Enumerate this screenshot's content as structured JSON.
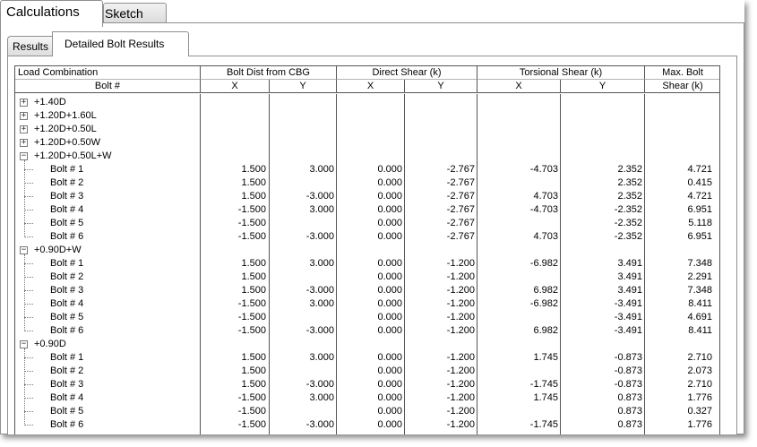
{
  "outer_tabs": [
    {
      "label": "Calculations",
      "active": true
    },
    {
      "label": "Sketch",
      "active": false
    }
  ],
  "inner_tabs": [
    {
      "label": "Results",
      "active": false
    },
    {
      "label": "Detailed Bolt Results",
      "active": true
    }
  ],
  "headers": {
    "load_combination": "Load Combination",
    "bolt_num": "Bolt #",
    "bolt_dist": "Bolt Dist from CBG",
    "direct_shear": "Direct Shear  (k)",
    "torsional_shear": "Torsional Shear  (k)",
    "max_bolt": "Max. Bolt",
    "max_bolt_shear": "Shear  (k)",
    "x": "X",
    "y": "Y"
  },
  "groups": [
    {
      "name": "+1.40D",
      "expanded": false,
      "bolts": []
    },
    {
      "name": "+1.20D+1.60L",
      "expanded": false,
      "bolts": []
    },
    {
      "name": "+1.20D+0.50L",
      "expanded": false,
      "bolts": []
    },
    {
      "name": "+1.20D+0.50W",
      "expanded": false,
      "bolts": []
    },
    {
      "name": "+1.20D+0.50L+W",
      "expanded": true,
      "bolts": [
        {
          "name": "Bolt # 1",
          "dx": "1.500",
          "dy": "3.000",
          "sx": "0.000",
          "sy": "-2.767",
          "tx": "-4.703",
          "ty": "2.352",
          "max": "4.721"
        },
        {
          "name": "Bolt # 2",
          "dx": "1.500",
          "dy": "",
          "sx": "0.000",
          "sy": "-2.767",
          "tx": "",
          "ty": "2.352",
          "max": "0.415"
        },
        {
          "name": "Bolt # 3",
          "dx": "1.500",
          "dy": "-3.000",
          "sx": "0.000",
          "sy": "-2.767",
          "tx": "4.703",
          "ty": "2.352",
          "max": "4.721"
        },
        {
          "name": "Bolt # 4",
          "dx": "-1.500",
          "dy": "3.000",
          "sx": "0.000",
          "sy": "-2.767",
          "tx": "-4.703",
          "ty": "-2.352",
          "max": "6.951"
        },
        {
          "name": "Bolt # 5",
          "dx": "-1.500",
          "dy": "",
          "sx": "0.000",
          "sy": "-2.767",
          "tx": "",
          "ty": "-2.352",
          "max": "5.118"
        },
        {
          "name": "Bolt # 6",
          "dx": "-1.500",
          "dy": "-3.000",
          "sx": "0.000",
          "sy": "-2.767",
          "tx": "4.703",
          "ty": "-2.352",
          "max": "6.951"
        }
      ]
    },
    {
      "name": "+0.90D+W",
      "expanded": true,
      "bolts": [
        {
          "name": "Bolt # 1",
          "dx": "1.500",
          "dy": "3.000",
          "sx": "0.000",
          "sy": "-1.200",
          "tx": "-6.982",
          "ty": "3.491",
          "max": "7.348"
        },
        {
          "name": "Bolt # 2",
          "dx": "1.500",
          "dy": "",
          "sx": "0.000",
          "sy": "-1.200",
          "tx": "",
          "ty": "3.491",
          "max": "2.291"
        },
        {
          "name": "Bolt # 3",
          "dx": "1.500",
          "dy": "-3.000",
          "sx": "0.000",
          "sy": "-1.200",
          "tx": "6.982",
          "ty": "3.491",
          "max": "7.348"
        },
        {
          "name": "Bolt # 4",
          "dx": "-1.500",
          "dy": "3.000",
          "sx": "0.000",
          "sy": "-1.200",
          "tx": "-6.982",
          "ty": "-3.491",
          "max": "8.411"
        },
        {
          "name": "Bolt # 5",
          "dx": "-1.500",
          "dy": "",
          "sx": "0.000",
          "sy": "-1.200",
          "tx": "",
          "ty": "-3.491",
          "max": "4.691"
        },
        {
          "name": "Bolt # 6",
          "dx": "-1.500",
          "dy": "-3.000",
          "sx": "0.000",
          "sy": "-1.200",
          "tx": "6.982",
          "ty": "-3.491",
          "max": "8.411"
        }
      ]
    },
    {
      "name": "+0.90D",
      "expanded": true,
      "bolts": [
        {
          "name": "Bolt # 1",
          "dx": "1.500",
          "dy": "3.000",
          "sx": "0.000",
          "sy": "-1.200",
          "tx": "1.745",
          "ty": "-0.873",
          "max": "2.710"
        },
        {
          "name": "Bolt # 2",
          "dx": "1.500",
          "dy": "",
          "sx": "0.000",
          "sy": "-1.200",
          "tx": "",
          "ty": "-0.873",
          "max": "2.073"
        },
        {
          "name": "Bolt # 3",
          "dx": "1.500",
          "dy": "-3.000",
          "sx": "0.000",
          "sy": "-1.200",
          "tx": "-1.745",
          "ty": "-0.873",
          "max": "2.710"
        },
        {
          "name": "Bolt # 4",
          "dx": "-1.500",
          "dy": "3.000",
          "sx": "0.000",
          "sy": "-1.200",
          "tx": "1.745",
          "ty": "0.873",
          "max": "1.776"
        },
        {
          "name": "Bolt # 5",
          "dx": "-1.500",
          "dy": "",
          "sx": "0.000",
          "sy": "-1.200",
          "tx": "",
          "ty": "0.873",
          "max": "0.327"
        },
        {
          "name": "Bolt # 6",
          "dx": "-1.500",
          "dy": "-3.000",
          "sx": "0.000",
          "sy": "-1.200",
          "tx": "-1.745",
          "ty": "0.873",
          "max": "1.776"
        }
      ]
    }
  ]
}
